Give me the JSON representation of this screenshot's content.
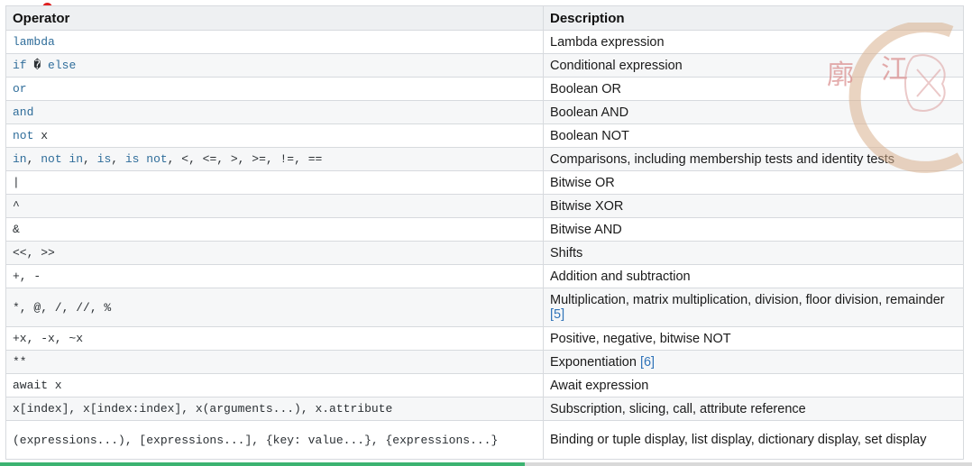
{
  "header": {
    "operator": "Operator",
    "description": "Description"
  },
  "rows": [
    {
      "op": [
        {
          "t": "lambda",
          "k": true
        }
      ],
      "desc": "Lambda expression"
    },
    {
      "op": [
        {
          "t": "if",
          "k": true
        },
        {
          "t": " � ",
          "k": false
        },
        {
          "t": "else",
          "k": true
        }
      ],
      "desc": "Conditional expression"
    },
    {
      "op": [
        {
          "t": "or",
          "k": true
        }
      ],
      "desc": "Boolean OR"
    },
    {
      "op": [
        {
          "t": "and",
          "k": true
        }
      ],
      "desc": "Boolean AND"
    },
    {
      "op": [
        {
          "t": "not",
          "k": true
        },
        {
          "t": " x",
          "k": false
        }
      ],
      "desc": "Boolean NOT"
    },
    {
      "op": [
        {
          "t": "in",
          "k": true
        },
        {
          "t": ", ",
          "k": false
        },
        {
          "t": "not in",
          "k": true
        },
        {
          "t": ", ",
          "k": false
        },
        {
          "t": "is",
          "k": true
        },
        {
          "t": ", ",
          "k": false
        },
        {
          "t": "is not",
          "k": true
        },
        {
          "t": ", <, <=, >, >=, !=, ==",
          "k": false
        }
      ],
      "desc": "Comparisons, including membership tests and identity tests"
    },
    {
      "op": [
        {
          "t": "|",
          "k": false
        }
      ],
      "desc": "Bitwise OR"
    },
    {
      "op": [
        {
          "t": "^",
          "k": false
        }
      ],
      "desc": "Bitwise XOR"
    },
    {
      "op": [
        {
          "t": "&",
          "k": false
        }
      ],
      "desc": "Bitwise AND"
    },
    {
      "op": [
        {
          "t": "<<, >>",
          "k": false
        }
      ],
      "desc": "Shifts"
    },
    {
      "op": [
        {
          "t": "+, -",
          "k": false
        }
      ],
      "desc": "Addition and subtraction"
    },
    {
      "op": [
        {
          "t": "*, @, /, //, %",
          "k": false
        }
      ],
      "desc": "Multiplication, matrix multiplication, division, floor division, remainder",
      "ref": "[5]",
      "tall": true
    },
    {
      "op": [
        {
          "t": "+x, -x, ~x",
          "k": false
        }
      ],
      "desc": "Positive, negative, bitwise NOT"
    },
    {
      "op": [
        {
          "t": "**",
          "k": false
        }
      ],
      "desc": "Exponentiation",
      "ref": "[6]"
    },
    {
      "op": [
        {
          "t": "await x",
          "k": false
        }
      ],
      "desc": "Await expression"
    },
    {
      "op": [
        {
          "t": "x[index], x[index:index], x(arguments...), x.attribute",
          "k": false
        }
      ],
      "desc": "Subscription, slicing, call, attribute reference"
    },
    {
      "op": [
        {
          "t": "(expressions...), [expressions...], {key: value...}, {expressions...}",
          "k": false
        }
      ],
      "desc": "Binding or tuple display, list display, dictionary display, set display",
      "tall": true
    }
  ],
  "video_progress": 0.54,
  "colors": {
    "keyword": "#2f6d9a",
    "reference": "#2f73b8",
    "progress": "#3cb371",
    "header_bg": "#eef0f2"
  }
}
